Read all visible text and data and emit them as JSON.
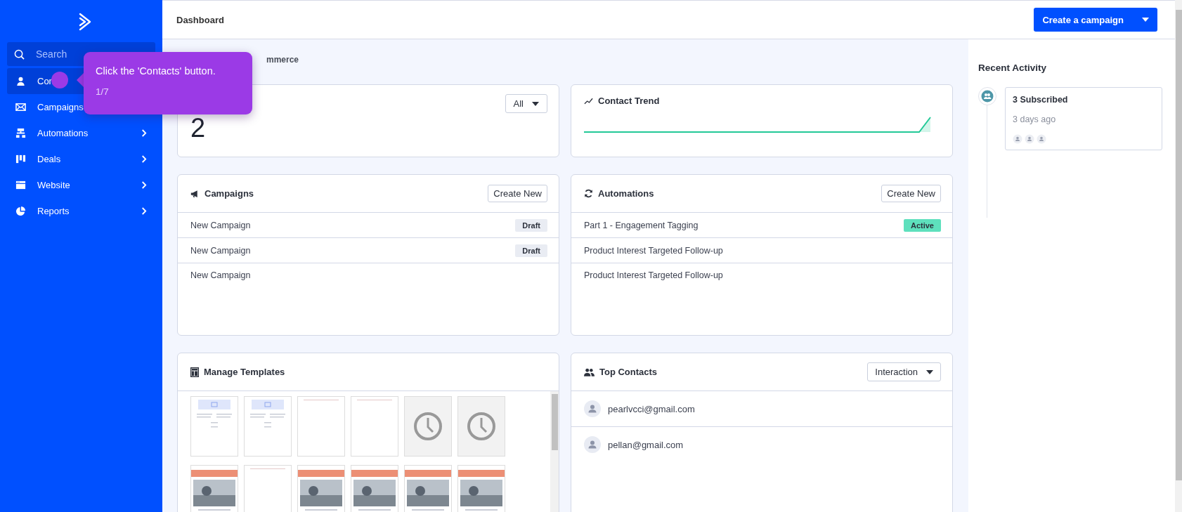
{
  "sidebar": {
    "search": {
      "placeholder": "Search"
    },
    "items": [
      {
        "label": "Con",
        "selected": true,
        "expandable": false
      },
      {
        "label": "Campaigns",
        "selected": false,
        "expandable": false
      },
      {
        "label": "Automations",
        "selected": false,
        "expandable": true
      },
      {
        "label": "Deals",
        "selected": false,
        "expandable": true
      },
      {
        "label": "Website",
        "selected": false,
        "expandable": true
      },
      {
        "label": "Reports",
        "selected": false,
        "expandable": true
      }
    ]
  },
  "top_bar": {
    "title": "Dashboard",
    "button": "Create a campaign"
  },
  "section_label": "mmerce",
  "contacts_card": {
    "count": "2",
    "filter": "All"
  },
  "trend_card": {
    "title": "Contact Trend"
  },
  "campaigns": {
    "title": "Campaigns",
    "button": "Create New",
    "rows": [
      {
        "name": "New Campaign",
        "status": "Draft",
        "color": "#e9ecf3"
      },
      {
        "name": "New Campaign",
        "status": "Draft",
        "color": "#e9ecf3"
      },
      {
        "name": "New Campaign"
      }
    ]
  },
  "automations": {
    "title": "Automations",
    "button": "Create New",
    "rows": [
      {
        "name": "Part 1 - Engagement Tagging",
        "status": "Active",
        "color": "#5ee0bd"
      },
      {
        "name": "Product Interest Targeted Follow-up"
      },
      {
        "name": "Product Interest Targeted Follow-up"
      }
    ]
  },
  "templates": {
    "title": "Manage Templates",
    "thumbnails": [
      {
        "kind": "layout"
      },
      {
        "kind": "layout"
      },
      {
        "kind": "blank"
      },
      {
        "kind": "blank"
      },
      {
        "kind": "clock"
      },
      {
        "kind": "clock"
      },
      {
        "kind": "picture"
      },
      {
        "kind": "blank"
      },
      {
        "kind": "picture"
      },
      {
        "kind": "picture"
      },
      {
        "kind": "picture"
      },
      {
        "kind": "picture"
      }
    ]
  },
  "top_contacts": {
    "title": "Top Contacts",
    "filter": "Interaction",
    "contacts": [
      {
        "email": "pearlvcci@gmail.com"
      },
      {
        "email": "pellan@gmail.com"
      }
    ]
  },
  "recent_activity": {
    "title": "Recent Activity",
    "items": [
      {
        "title": "3 Subscribed",
        "time": "3 days ago"
      }
    ]
  },
  "tour": {
    "message": "Click the 'Contacts' button.",
    "step": "1/7"
  }
}
